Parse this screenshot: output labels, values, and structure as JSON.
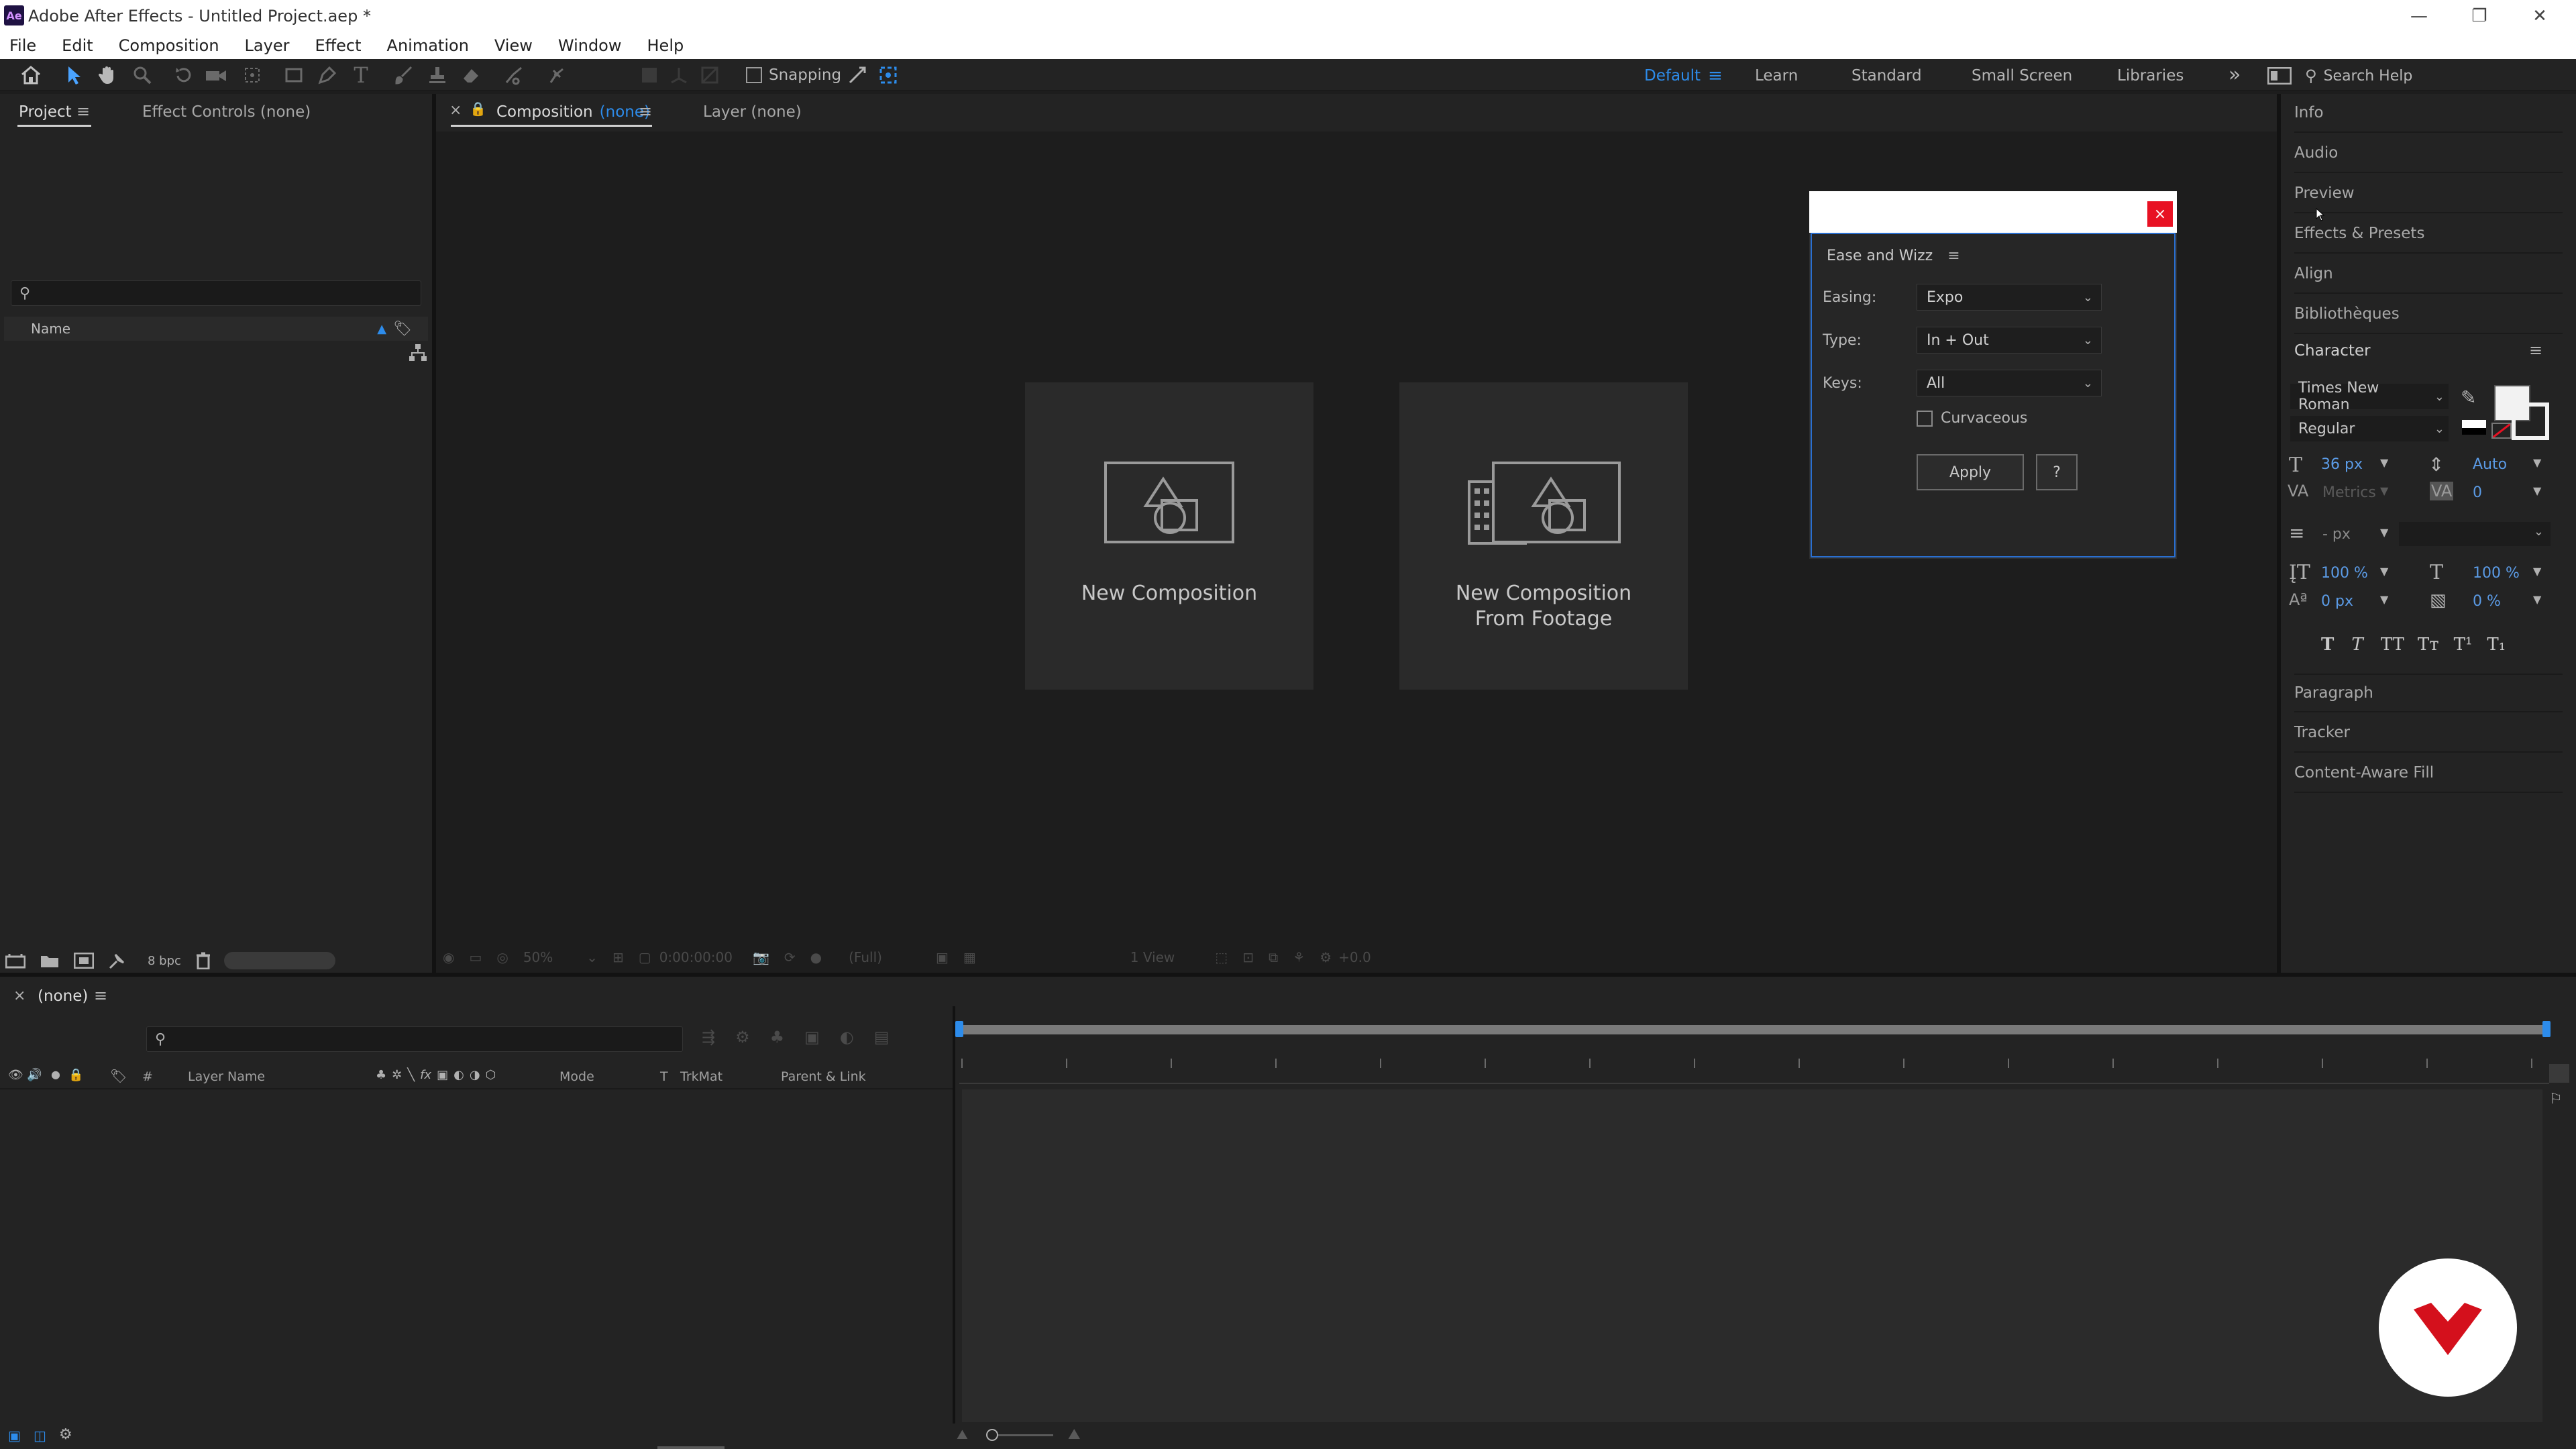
{
  "window": {
    "app_icon": "Ae",
    "title": "Adobe After Effects - Untitled Project.aep *"
  },
  "menu": [
    "File",
    "Edit",
    "Composition",
    "Layer",
    "Effect",
    "Animation",
    "View",
    "Window",
    "Help"
  ],
  "toolbar": {
    "snapping_label": "Snapping",
    "workspaces": [
      "Default",
      "Learn",
      "Standard",
      "Small Screen",
      "Libraries"
    ],
    "search_placeholder": "Search Help"
  },
  "project_panel": {
    "tabs": [
      "Project",
      "Effect Controls (none)"
    ],
    "column_name": "Name",
    "bpc": "8 bpc"
  },
  "comp_panel": {
    "tab_prefix": "Composition",
    "tab_highlight": "(none)",
    "layer_tab": "Layer (none)",
    "new_comp": "New Composition",
    "new_comp_footage_line1": "New Composition",
    "new_comp_footage_line2": "From Footage",
    "footer": {
      "zoom": "50%",
      "timecode": "0:00:00:00",
      "resolution": "(Full)",
      "view": "1 View",
      "exposure": "+0.0"
    }
  },
  "dialog": {
    "panel_title": "Ease and Wizz",
    "close_glyph": "×",
    "easing_label": "Easing:",
    "easing_value": "Expo",
    "type_label": "Type:",
    "type_value": "In + Out",
    "keys_label": "Keys:",
    "keys_value": "All",
    "curvaceous_label": "Curvaceous",
    "apply_label": "Apply",
    "help_label": "?"
  },
  "right_panel": {
    "items_top": [
      "Info",
      "Audio",
      "Preview",
      "Effects & Presets",
      "Align",
      "Bibliothèques"
    ],
    "character_title": "Character",
    "font": "Times New Roman",
    "style": "Regular",
    "font_size": "36 px",
    "leading": "Auto",
    "kerning": "Metrics",
    "tracking": "0",
    "stroke_width": "- px",
    "vscale": "100 %",
    "hscale": "100 %",
    "baseline": "0 px",
    "tsume": "0 %",
    "style_buttons": [
      "T",
      "T",
      "TT",
      "Tт",
      "T¹",
      "T₁"
    ],
    "items_bottom": [
      "Paragraph",
      "Tracker",
      "Content-Aware Fill"
    ]
  },
  "timeline": {
    "tab": "(none)",
    "col_layer_name": "Layer Name",
    "col_mode": "Mode",
    "col_t": "T",
    "col_trkmat": "TrkMat",
    "col_parent": "Parent & Link",
    "col_hash": "#"
  },
  "colors": {
    "accent": "#2d8ceb",
    "dialog_border": "#2a6fd0",
    "close_red": "#e81123",
    "brand_red": "#d4101c"
  }
}
